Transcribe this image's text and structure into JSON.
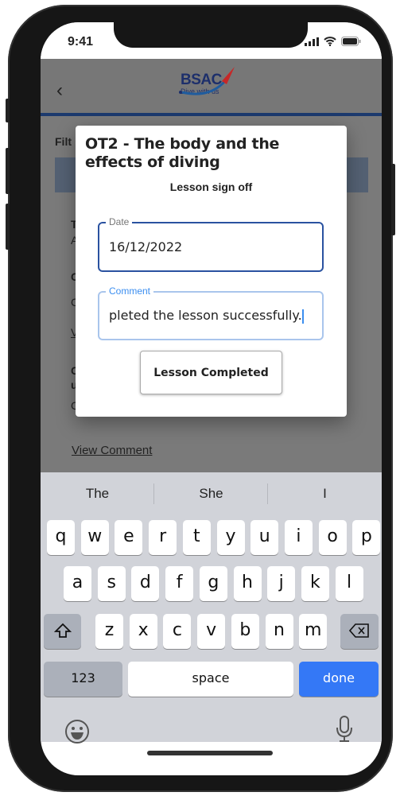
{
  "status_bar": {
    "time": "9:41",
    "icons": [
      "cellular-icon",
      "wifi-icon",
      "battery-icon"
    ]
  },
  "header": {
    "back_icon": "chevron-left-icon",
    "logo_text": "BSAC",
    "logo_tagline": "Dive with us"
  },
  "background": {
    "filter_label": "Filt",
    "fragments": [
      "T",
      "A",
      "C",
      "C",
      "V",
      "C",
      "u",
      "C"
    ],
    "view_comment": "View Comment"
  },
  "dialog": {
    "title": "OT2 - The body and the effects of diving",
    "subtitle": "Lesson sign off",
    "date_label": "Date",
    "date_value": "16/12/2022",
    "comment_label": "Comment",
    "comment_value": "pleted the lesson successfully.",
    "button": "Lesson Completed"
  },
  "colors": {
    "accent": "#2a52a0",
    "comment_focus": "#3b8ef0",
    "done_key": "#3478f6",
    "header_line": "#1c3a6e"
  },
  "keyboard": {
    "suggestions": [
      "The",
      "She",
      "I"
    ],
    "row1": [
      "q",
      "w",
      "e",
      "r",
      "t",
      "y",
      "u",
      "i",
      "o",
      "p"
    ],
    "row2": [
      "a",
      "s",
      "d",
      "f",
      "g",
      "h",
      "j",
      "k",
      "l"
    ],
    "row3": [
      "z",
      "x",
      "c",
      "v",
      "b",
      "n",
      "m"
    ],
    "numbers": "123",
    "space": "space",
    "done": "done",
    "shift_icon": "shift-icon",
    "backspace_icon": "backspace-icon",
    "emoji_icon": "emoji-icon",
    "mic_icon": "microphone-icon"
  }
}
